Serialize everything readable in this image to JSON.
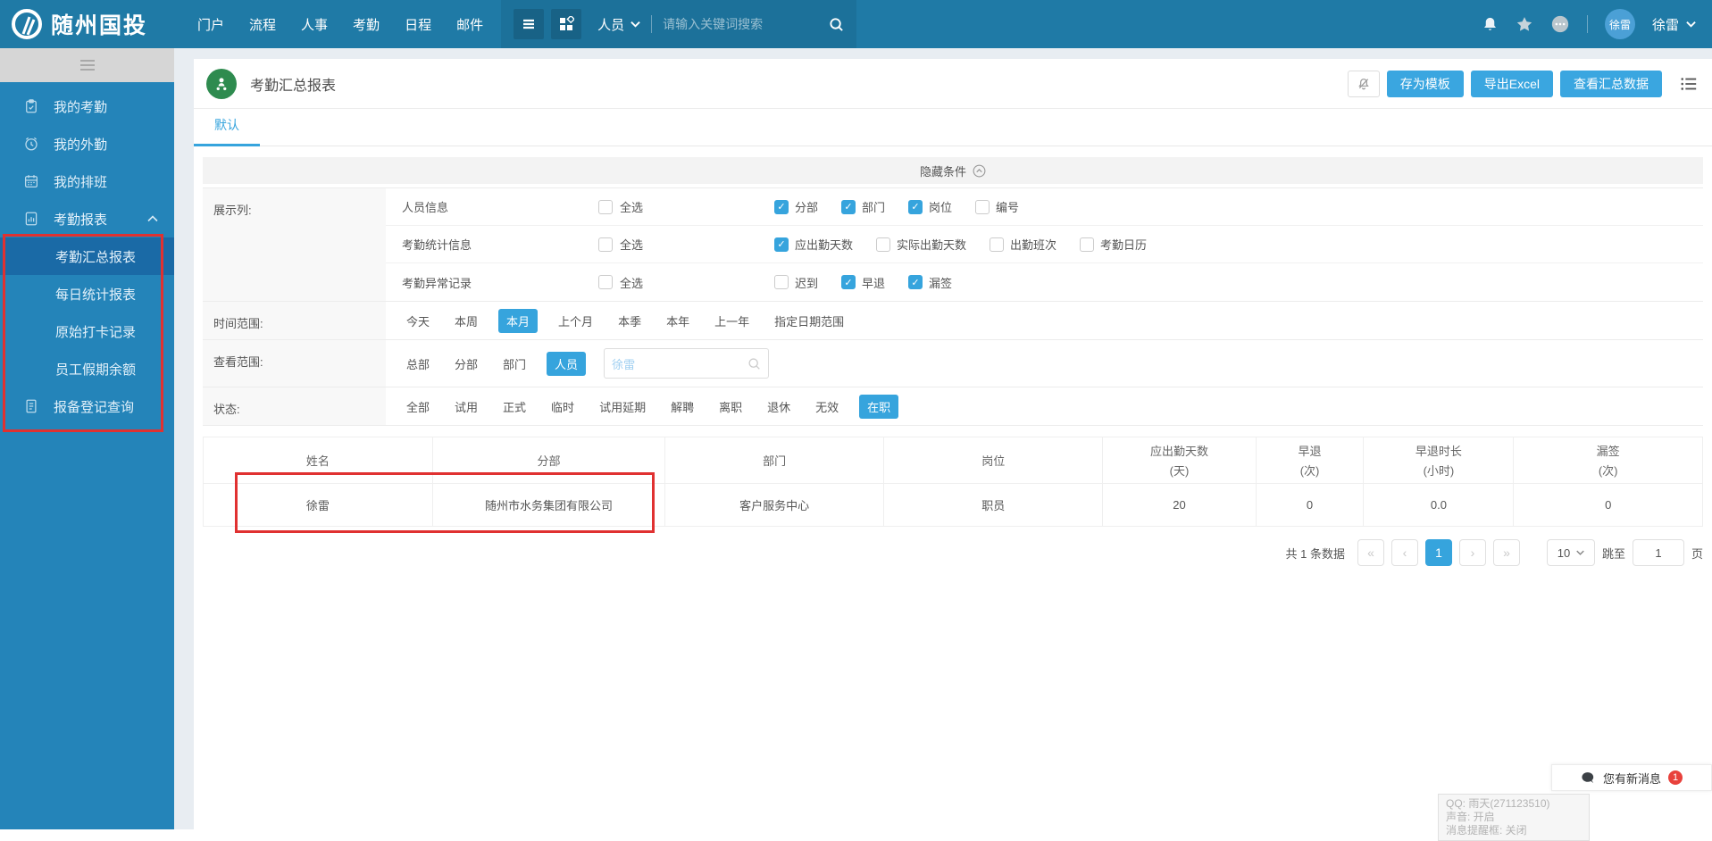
{
  "navbar": {
    "brand": "随州国投",
    "menu": [
      "门户",
      "流程",
      "人事",
      "考勤",
      "日程",
      "邮件"
    ],
    "scope_select": "人员",
    "search_placeholder": "请输入关键词搜索",
    "user_name": "徐雷",
    "avatar_text": "徐雷"
  },
  "sidebar": {
    "items": [
      {
        "label": "我的考勤",
        "icon": "clipboard-icon",
        "type": "top"
      },
      {
        "label": "我的外勤",
        "icon": "clock-icon",
        "type": "top"
      },
      {
        "label": "我的排班",
        "icon": "calendar-icon",
        "type": "top"
      },
      {
        "label": "考勤报表",
        "icon": "report-icon",
        "type": "top",
        "expanded": true
      },
      {
        "label": "考勤汇总报表",
        "type": "sub",
        "active": true
      },
      {
        "label": "每日统计报表",
        "type": "sub"
      },
      {
        "label": "原始打卡记录",
        "type": "sub"
      },
      {
        "label": "员工假期余额",
        "type": "sub"
      },
      {
        "label": "报备登记查询",
        "icon": "doc-icon",
        "type": "top"
      }
    ]
  },
  "page": {
    "title": "考勤汇总报表",
    "tab": "默认",
    "action_buttons": [
      "存为模板",
      "导出Excel",
      "查看汇总数据"
    ]
  },
  "filters": {
    "hide_label": "隐藏条件",
    "display": {
      "label": "展示列:",
      "groups": [
        {
          "name": "人员信息",
          "select_all": "全选",
          "select_all_checked": false,
          "options": [
            {
              "label": "分部",
              "checked": true
            },
            {
              "label": "部门",
              "checked": true
            },
            {
              "label": "岗位",
              "checked": true
            },
            {
              "label": "编号",
              "checked": false
            }
          ]
        },
        {
          "name": "考勤统计信息",
          "select_all": "全选",
          "select_all_checked": false,
          "options": [
            {
              "label": "应出勤天数",
              "checked": true
            },
            {
              "label": "实际出勤天数",
              "checked": false
            },
            {
              "label": "出勤班次",
              "checked": false
            },
            {
              "label": "考勤日历",
              "checked": false
            }
          ]
        },
        {
          "name": "考勤异常记录",
          "select_all": "全选",
          "select_all_checked": false,
          "options": [
            {
              "label": "迟到",
              "checked": false
            },
            {
              "label": "早退",
              "checked": true
            },
            {
              "label": "漏签",
              "checked": true
            }
          ]
        }
      ]
    },
    "time_range": {
      "label": "时间范围:",
      "selected": "本月",
      "options": [
        "今天",
        "本周",
        "本月",
        "上个月",
        "本季",
        "本年",
        "上一年",
        "指定日期范围"
      ]
    },
    "view_range": {
      "label": "查看范围:",
      "selected": "人员",
      "options": [
        "总部",
        "分部",
        "部门",
        "人员"
      ],
      "search_value": "徐雷"
    },
    "status": {
      "label": "状态:",
      "selected": "在职",
      "options": [
        "全部",
        "试用",
        "正式",
        "临时",
        "试用延期",
        "解聘",
        "离职",
        "退休",
        "无效",
        "在职"
      ]
    }
  },
  "table": {
    "headers": [
      {
        "t": "姓名"
      },
      {
        "t": "分部"
      },
      {
        "t": "部门"
      },
      {
        "t": "岗位"
      },
      {
        "t": "应出勤天数",
        "s": "(天)"
      },
      {
        "t": "早退",
        "s": "(次)"
      },
      {
        "t": "早退时长",
        "s": "(小时)"
      },
      {
        "t": "漏签",
        "s": "(次)"
      }
    ],
    "rows": [
      [
        "徐雷",
        "随州市水务集团有限公司",
        "客户服务中心",
        "职员",
        "20",
        "0",
        "0.0",
        "0"
      ]
    ]
  },
  "pagination": {
    "total_text": "共 1 条数据",
    "pages": [
      "1"
    ],
    "current": "1",
    "page_size": "10",
    "jump_label": "跳至",
    "jump_value": "1",
    "unit": "页"
  },
  "notification": {
    "text": "您有新消息",
    "badge": "1"
  },
  "qq_tooltip": {
    "lines": [
      "QQ: 雨天(271123510)",
      "声音: 开启",
      "消息提醒框: 关闭"
    ]
  },
  "colors": {
    "navbar": "#1f7aa6",
    "sidebar": "#2484b9",
    "sidebar_active": "#1a6aa6",
    "accent": "#36a4dd",
    "title_icon_green": "#2e8b4f",
    "annotation_red": "#e03131",
    "badge_red": "#e8413c"
  }
}
